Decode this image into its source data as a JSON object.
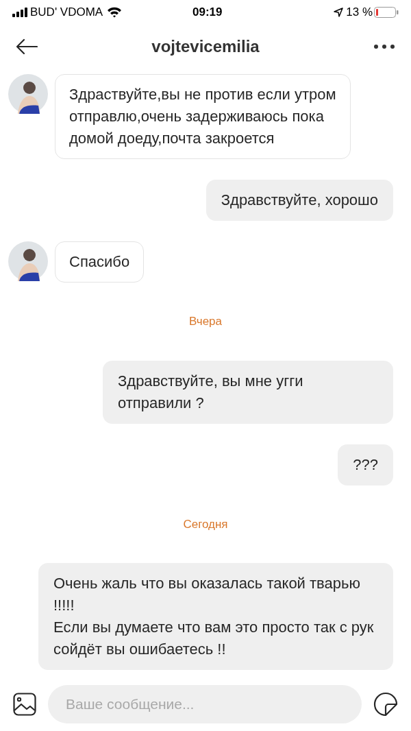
{
  "status_bar": {
    "carrier": "BUD' VDOMA",
    "time": "09:19",
    "battery": "13 %"
  },
  "header": {
    "title": "vojtevicemilia"
  },
  "messages": [
    {
      "kind": "incoming",
      "text": "Здраствуйте,вы не против если утром отправлю,очень задерживаюсь пока домой доеду,почта закроется"
    },
    {
      "kind": "outgoing",
      "text": "Здравствуйте, хорошо"
    },
    {
      "kind": "incoming",
      "text": "Спасибо"
    },
    {
      "kind": "date",
      "text": "Вчера"
    },
    {
      "kind": "outgoing",
      "text": "Здравствуйте, вы мне угги отправили ?"
    },
    {
      "kind": "outgoing",
      "text": "???"
    },
    {
      "kind": "date",
      "text": "Сегодня"
    },
    {
      "kind": "outgoing",
      "text": "Очень жаль что вы оказалась такой тварью !!!!!\nЕсли вы думаете что вам это просто так с рук сойдёт вы ошибаетесь !!"
    }
  ],
  "composer": {
    "placeholder": "Ваше сообщение..."
  }
}
